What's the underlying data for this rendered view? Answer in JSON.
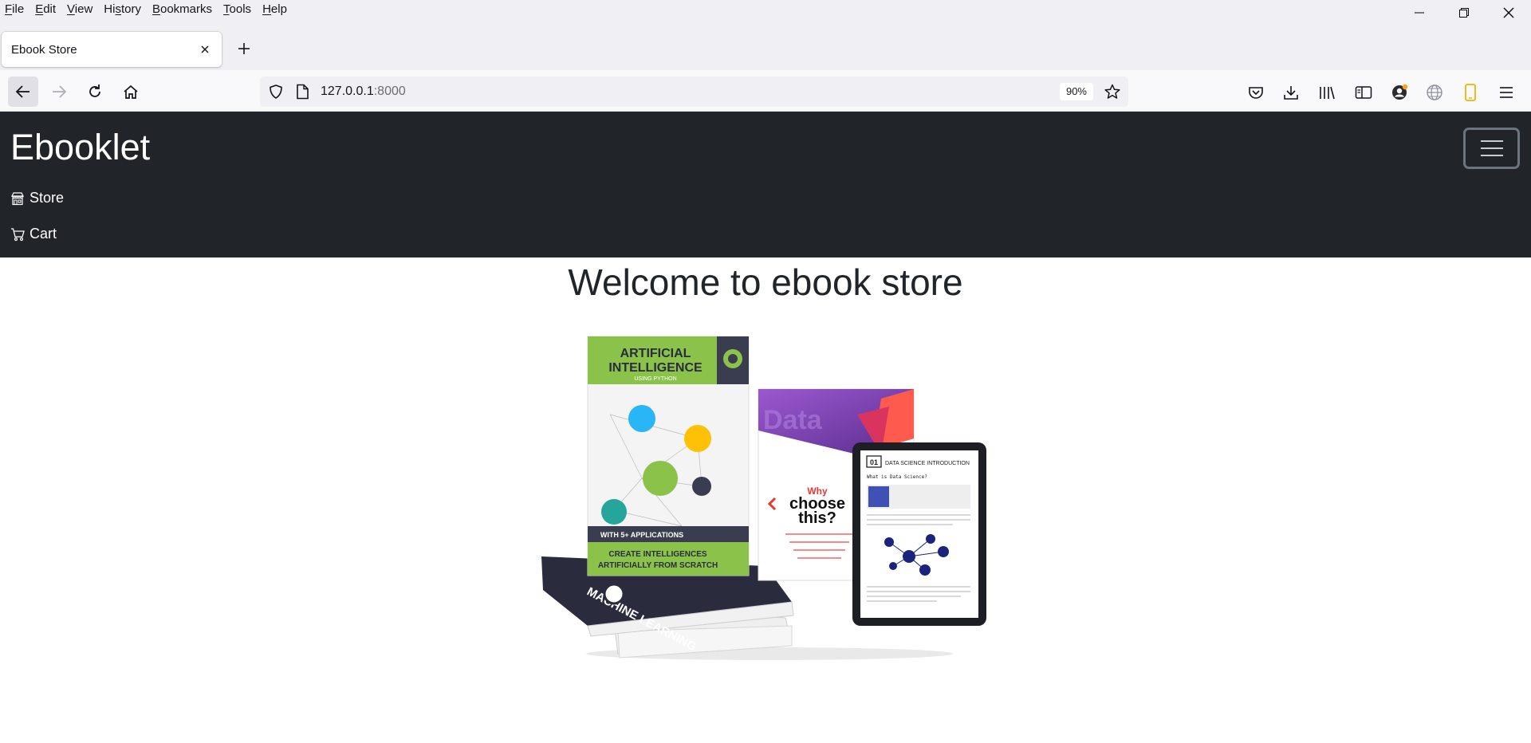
{
  "menubar": {
    "items": [
      "File",
      "Edit",
      "View",
      "History",
      "Bookmarks",
      "Tools",
      "Help"
    ],
    "accel": [
      "F",
      "E",
      "V",
      "s",
      "B",
      "T",
      "H"
    ]
  },
  "tab": {
    "title": "Ebook Store"
  },
  "url": {
    "host": "127.0.0.1",
    "port": ":8000",
    "zoom": "90%"
  },
  "site": {
    "brand": "Ebooklet",
    "nav": [
      {
        "label": "Store",
        "icon": "shop-icon"
      },
      {
        "label": "Cart",
        "icon": "cart-icon"
      }
    ],
    "heading": "Welcome to ebook store"
  },
  "hero_book": {
    "title_line1": "ARTIFICIAL",
    "title_line2": "INTELLIGENCE",
    "subtitle": "USING PYTHON",
    "badge": "WITH 5+ APPLICATIONS",
    "footer1": "CREATE INTELLIGENCES",
    "footer2": "ARTIFICIALLY FROM SCRATCH",
    "spine": "MACHINE LEARNING",
    "data_word": "Data",
    "why1": "Why",
    "why2": "choose",
    "why3": "this?",
    "tablet_num": "01",
    "tablet_title": "DATA SCIENCE INTRODUCTION",
    "tablet_q": "What is Data Science?"
  },
  "colors": {
    "site_nav_bg": "#212529",
    "chrome_bg": "#f0f0f4"
  }
}
